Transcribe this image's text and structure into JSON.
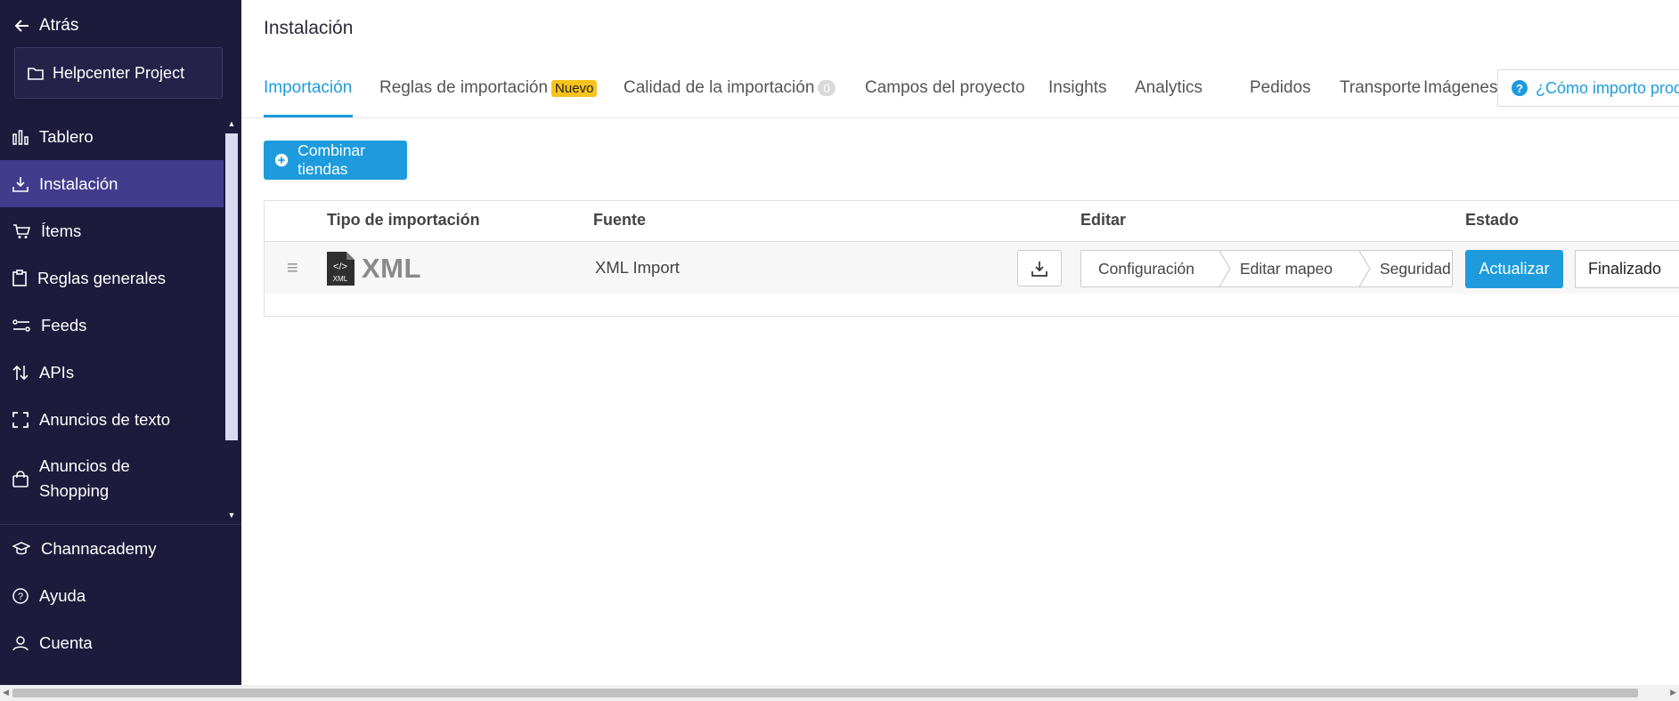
{
  "sidebar": {
    "back_label": "Atrás",
    "project_name": "Helpcenter Project",
    "items": [
      {
        "label": "Tablero",
        "icon": "chart-icon"
      },
      {
        "label": "Instalación",
        "icon": "download-tray-icon",
        "active": true
      },
      {
        "label": "Ítems",
        "icon": "cart-icon"
      },
      {
        "label": "Reglas generales",
        "icon": "clipboard-icon"
      },
      {
        "label": "Feeds",
        "icon": "feeds-icon"
      },
      {
        "label": "APIs",
        "icon": "arrows-updown-icon"
      },
      {
        "label": "Anuncios de texto",
        "icon": "frame-icon"
      },
      {
        "label": "Anuncios de Shopping",
        "icon": "shopping-bag-icon"
      }
    ],
    "bottom_items": [
      {
        "label": "Channacademy",
        "icon": "graduation-cap-icon"
      },
      {
        "label": "Ayuda",
        "icon": "question-circle-icon"
      },
      {
        "label": "Cuenta",
        "icon": "user-icon"
      }
    ]
  },
  "header": {
    "title": "Instalación"
  },
  "tabs": [
    {
      "label": "Importación",
      "active": true
    },
    {
      "label": "Reglas de importación",
      "badge": "Nuevo"
    },
    {
      "label": "Calidad de la importación",
      "count": "0"
    },
    {
      "label": "Campos del proyecto"
    },
    {
      "label": "Insights"
    },
    {
      "label": "Analytics"
    },
    {
      "label": "Pedidos"
    },
    {
      "label": "Transporte"
    },
    {
      "label": "Imágenes"
    }
  ],
  "help_link": "¿Cómo importo produ",
  "merge_button": "Combinar tiendas",
  "table": {
    "headers": [
      "Tipo de importación",
      "Fuente",
      "Editar",
      "Estado"
    ],
    "rows": [
      {
        "type_logo_text": "XML",
        "type_icon_label": "XML",
        "source": "XML Import",
        "steps": [
          "Configuración",
          "Editar mapeo",
          "Seguridad"
        ],
        "update_label": "Actualizar",
        "status": "Finalizado"
      }
    ]
  },
  "colors": {
    "sidebar_bg": "#1d1a3c",
    "sidebar_active": "#433c8c",
    "accent": "#1e9bdc",
    "badge_new": "#f7c21c"
  }
}
